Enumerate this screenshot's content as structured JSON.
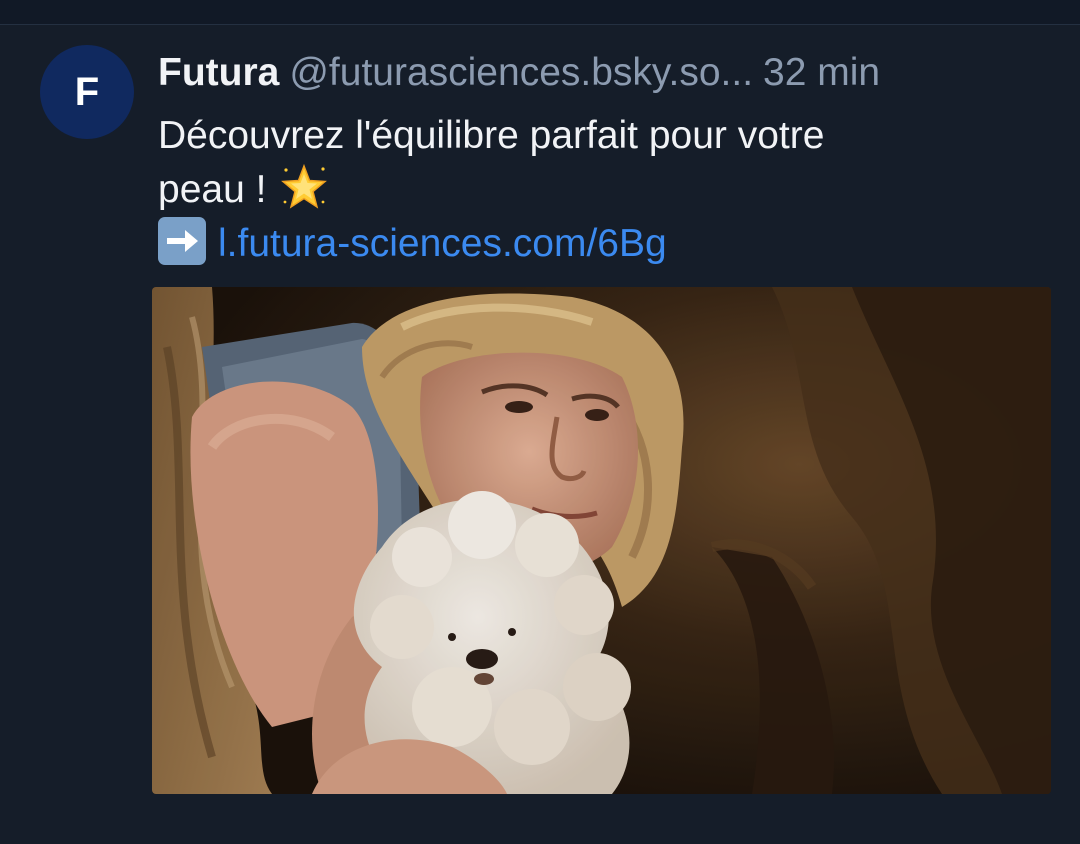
{
  "post": {
    "avatar_letter": "F",
    "display_name": "Futura",
    "handle": "@futurasciences.bsky.so...",
    "time": "32 min",
    "text_line1": "Découvrez l'équilibre parfait pour votre",
    "text_line2": "peau !",
    "link_text": "l.futura-sciences.com/6Bg",
    "icons": [
      "star-icon",
      "right-arrow-icon"
    ]
  },
  "colors": {
    "background": "#151d29",
    "avatar": "#10295f",
    "link": "#3b8af0",
    "secondary_text": "#8c9bb0"
  }
}
